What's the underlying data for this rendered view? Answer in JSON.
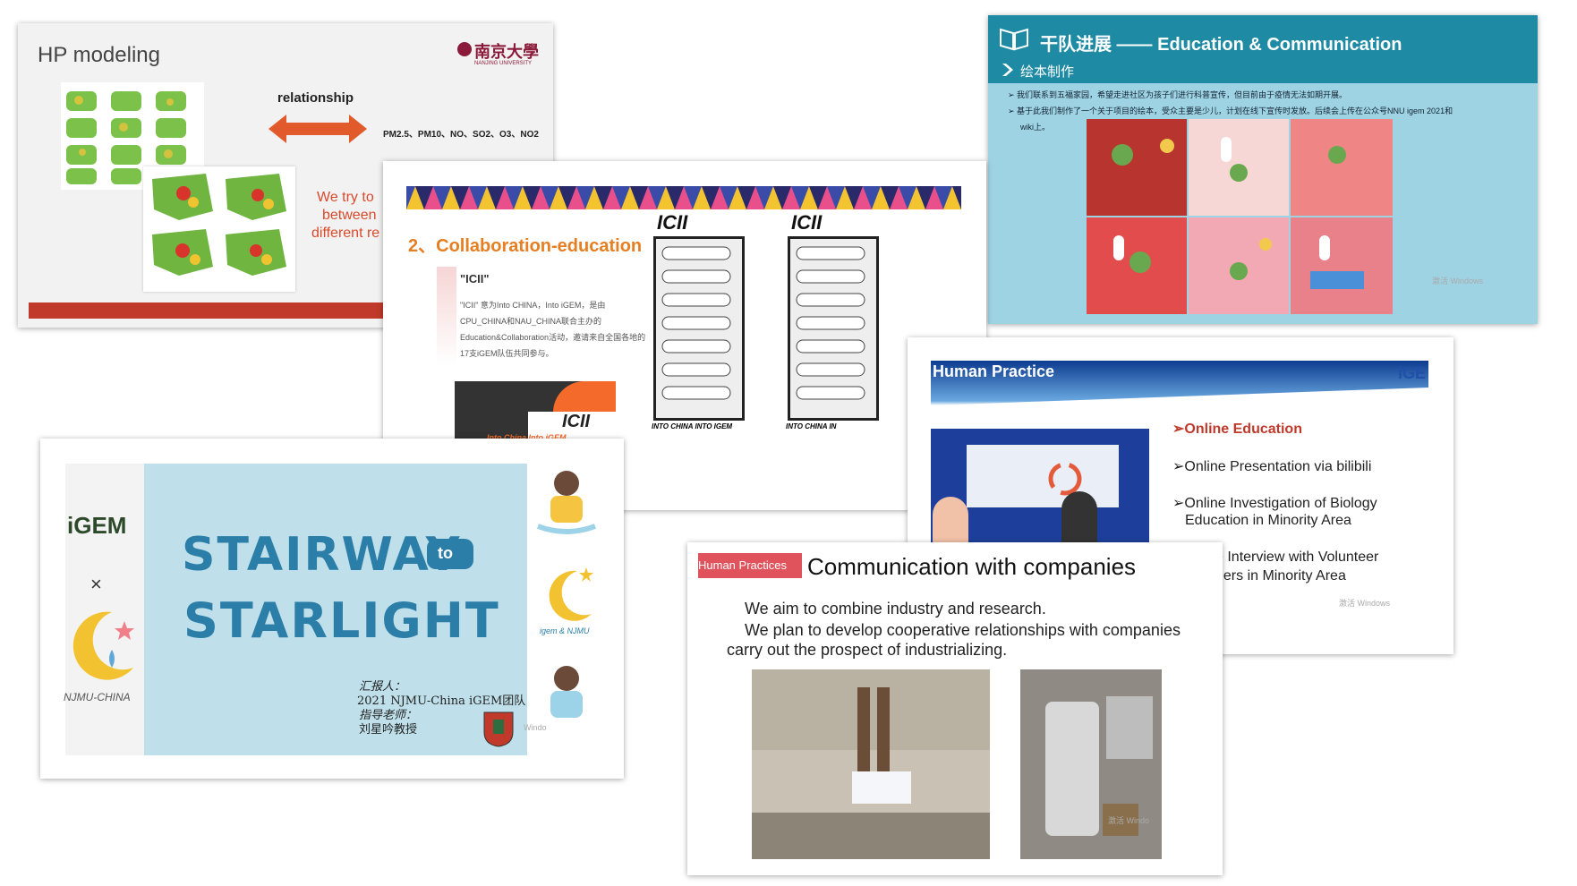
{
  "slides": {
    "hp_modeling": {
      "title": "HP modeling",
      "logo_text": "南京大學",
      "logo_sub": "NANJING UNIVERSITY",
      "relationship": "relationship",
      "pollutants": "PM2.5、PM10、NO、SO2、O3、NO2",
      "red_line1": "We try to",
      "red_line2": "between",
      "red_line3": "different re"
    },
    "collaboration": {
      "title": "2、Collaboration-education",
      "icii_label": "\"ICII\"",
      "body": "\"ICII\" 意为Into CHINA，Into iGEM，是由CPU_CHINA和NAU_CHINA联合主办的Education&Collaboration活动，邀请来自全国各地的17支iGEM队伍共同参与。",
      "poster_title": "ICII",
      "poster_sub": "Into China Into iGEM",
      "caption1": "INTO CHINA INTO IGEM",
      "caption2": "INTO CHINA IN"
    },
    "education": {
      "title": "干队进展 —— Education & Communication",
      "subtitle": "绘本制作",
      "line1": "➢ 我们联系到五福家园，希望走进社区为孩子们进行科普宣传，但目前由于疫情无法如期开展。",
      "line2": "➢ 基于此我们制作了一个关于项目的绘本，受众主要是少儿，计划在线下宣传时发放。后续会上传在公众号NNU igem 2021和",
      "line3": "wiki上。",
      "watermark": "激活 Windows"
    },
    "stairway": {
      "brand": "iGEM",
      "x": "×",
      "team": "NJMU-CHINA",
      "big1": "STAIRWAY",
      "big_to": "to",
      "big2": "STARLIGHT",
      "reporter_label": "汇报人：",
      "reporter": "2021 NJMU-China iGEM团队",
      "advisor_label": "指导老师：",
      "advisor": "刘星吟教授",
      "side_label": "igem & NJMU",
      "watermark": "Windo"
    },
    "human_practice": {
      "title": "Human Practice",
      "logo": "iGE",
      "items": [
        "➢Online Education",
        "➢Online Presentation via bilibili",
        "➢Online Investigation of Biology",
        "Education in Minority Area",
        "e Interview with Volunteer",
        "ners in Minority Area"
      ],
      "watermark": "激活 Windows"
    },
    "companies": {
      "tag": "Human Practices",
      "title": "Communication with companies",
      "p1": "We aim to combine industry and research.",
      "p2": "We plan to develop cooperative relationships with companies",
      "p3": "carry out the prospect of industrializing.",
      "watermark": "激活 Windo"
    }
  },
  "colors": {
    "hp_red": "#c0392b",
    "collab_orange": "#e67e22",
    "edu_teal": "#1e8aa3",
    "stair_blue": "#2a7ea8",
    "hp_blue": "#0d3c8f",
    "tag_red": "#e0525c"
  }
}
